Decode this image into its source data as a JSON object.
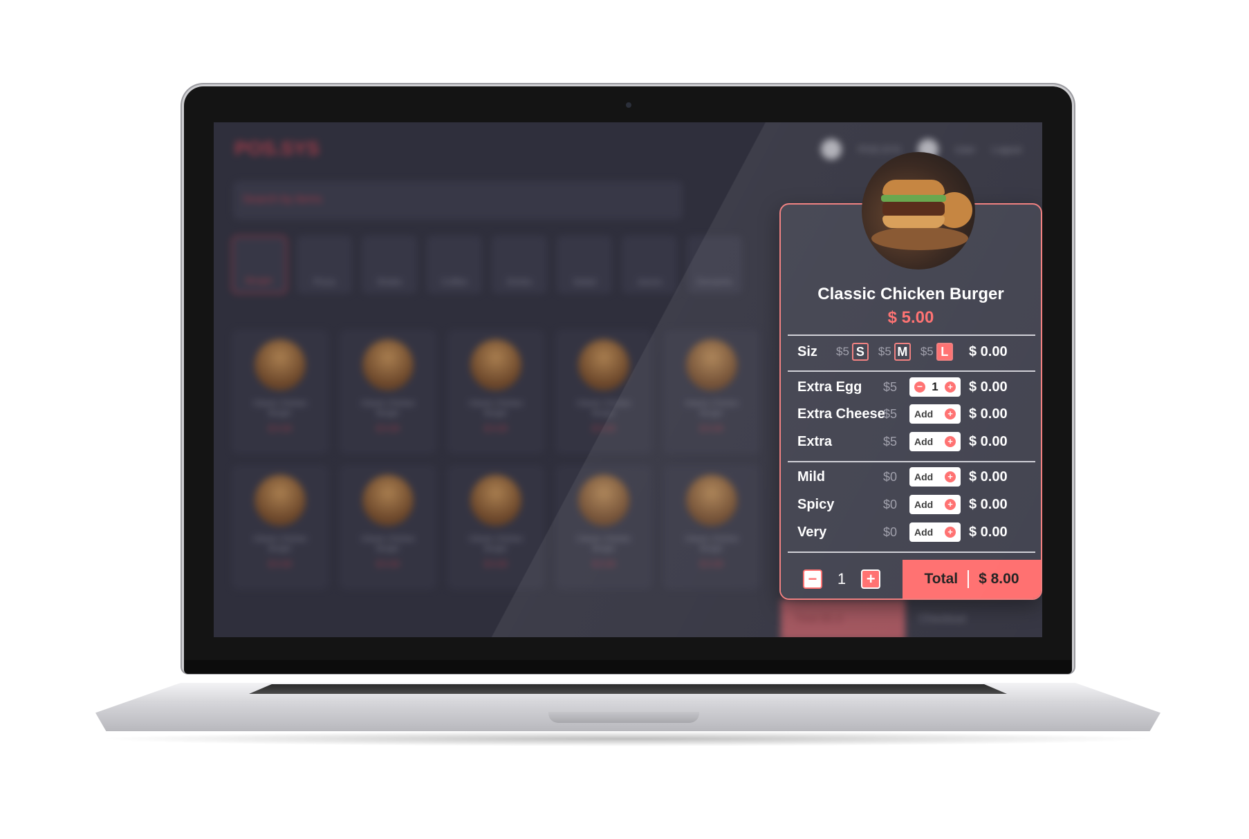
{
  "background_app": {
    "brand": "POS.SYS",
    "header": {
      "store": "POS.SYS",
      "user": "User",
      "logout": "Logout"
    },
    "search_placeholder": "Search by items",
    "categories": [
      "Burger",
      "Pizza",
      "Shake",
      "Coffee",
      "Drinks",
      "Salad",
      "Juices",
      "Desserts"
    ],
    "active_category": "Burger",
    "items": [
      {
        "name": "Classic Chicken Burger",
        "price": "$ 5.00"
      },
      {
        "name": "Classic Chicken Burger",
        "price": "$ 5.00"
      },
      {
        "name": "Classic Chicken Burger",
        "price": "$ 5.00"
      },
      {
        "name": "Classic Chicken Burger",
        "price": "$ 5.00"
      },
      {
        "name": "Classic Chicken Burger",
        "price": "$ 5.00"
      },
      {
        "name": "Classic Chicken Burger",
        "price": "$ 5.00"
      },
      {
        "name": "Classic Chicken Burger",
        "price": "$ 5.00"
      },
      {
        "name": "Classic Chicken Burger",
        "price": "$ 5.00"
      },
      {
        "name": "Classic Chicken Burger",
        "price": "$ 5.00"
      },
      {
        "name": "Classic Chicken Burger",
        "price": "$ 5.00"
      }
    ],
    "footer": {
      "total_label": "Total",
      "total_value": "$5.8",
      "checkout": "Checkout"
    }
  },
  "product_modal": {
    "title": "Classic Chicken Burger",
    "price": "$ 5.00",
    "size": {
      "label": "Siz",
      "options": [
        {
          "cost": "$5",
          "code": "S",
          "active": false
        },
        {
          "cost": "$5",
          "code": "M",
          "active": false
        },
        {
          "cost": "$5",
          "code": "L",
          "active": true
        }
      ],
      "amount": "$ 0.00"
    },
    "extras": [
      {
        "label": "Extra Egg",
        "cost": "$5",
        "control": "stepper",
        "qty": "1",
        "amount": "$ 0.00"
      },
      {
        "label": "Extra Cheese",
        "cost": "$5",
        "control": "add",
        "add_label": "Add",
        "amount": "$ 0.00"
      },
      {
        "label": "Extra",
        "cost": "$5",
        "control": "add",
        "add_label": "Add",
        "amount": "$ 0.00"
      }
    ],
    "spice": [
      {
        "label": "Mild",
        "cost": "$0",
        "add_label": "Add",
        "amount": "$ 0.00"
      },
      {
        "label": "Spicy",
        "cost": "$0",
        "add_label": "Add",
        "amount": "$ 0.00"
      },
      {
        "label": "Very",
        "cost": "$0",
        "add_label": "Add",
        "amount": "$ 0.00"
      }
    ],
    "footer": {
      "quantity": "1",
      "total_label": "Total",
      "total_value": "$ 8.00"
    }
  },
  "colors": {
    "accent": "#ff6b6b",
    "panel": "#3c3d4a",
    "screen_bg": "#2f2f3c"
  }
}
